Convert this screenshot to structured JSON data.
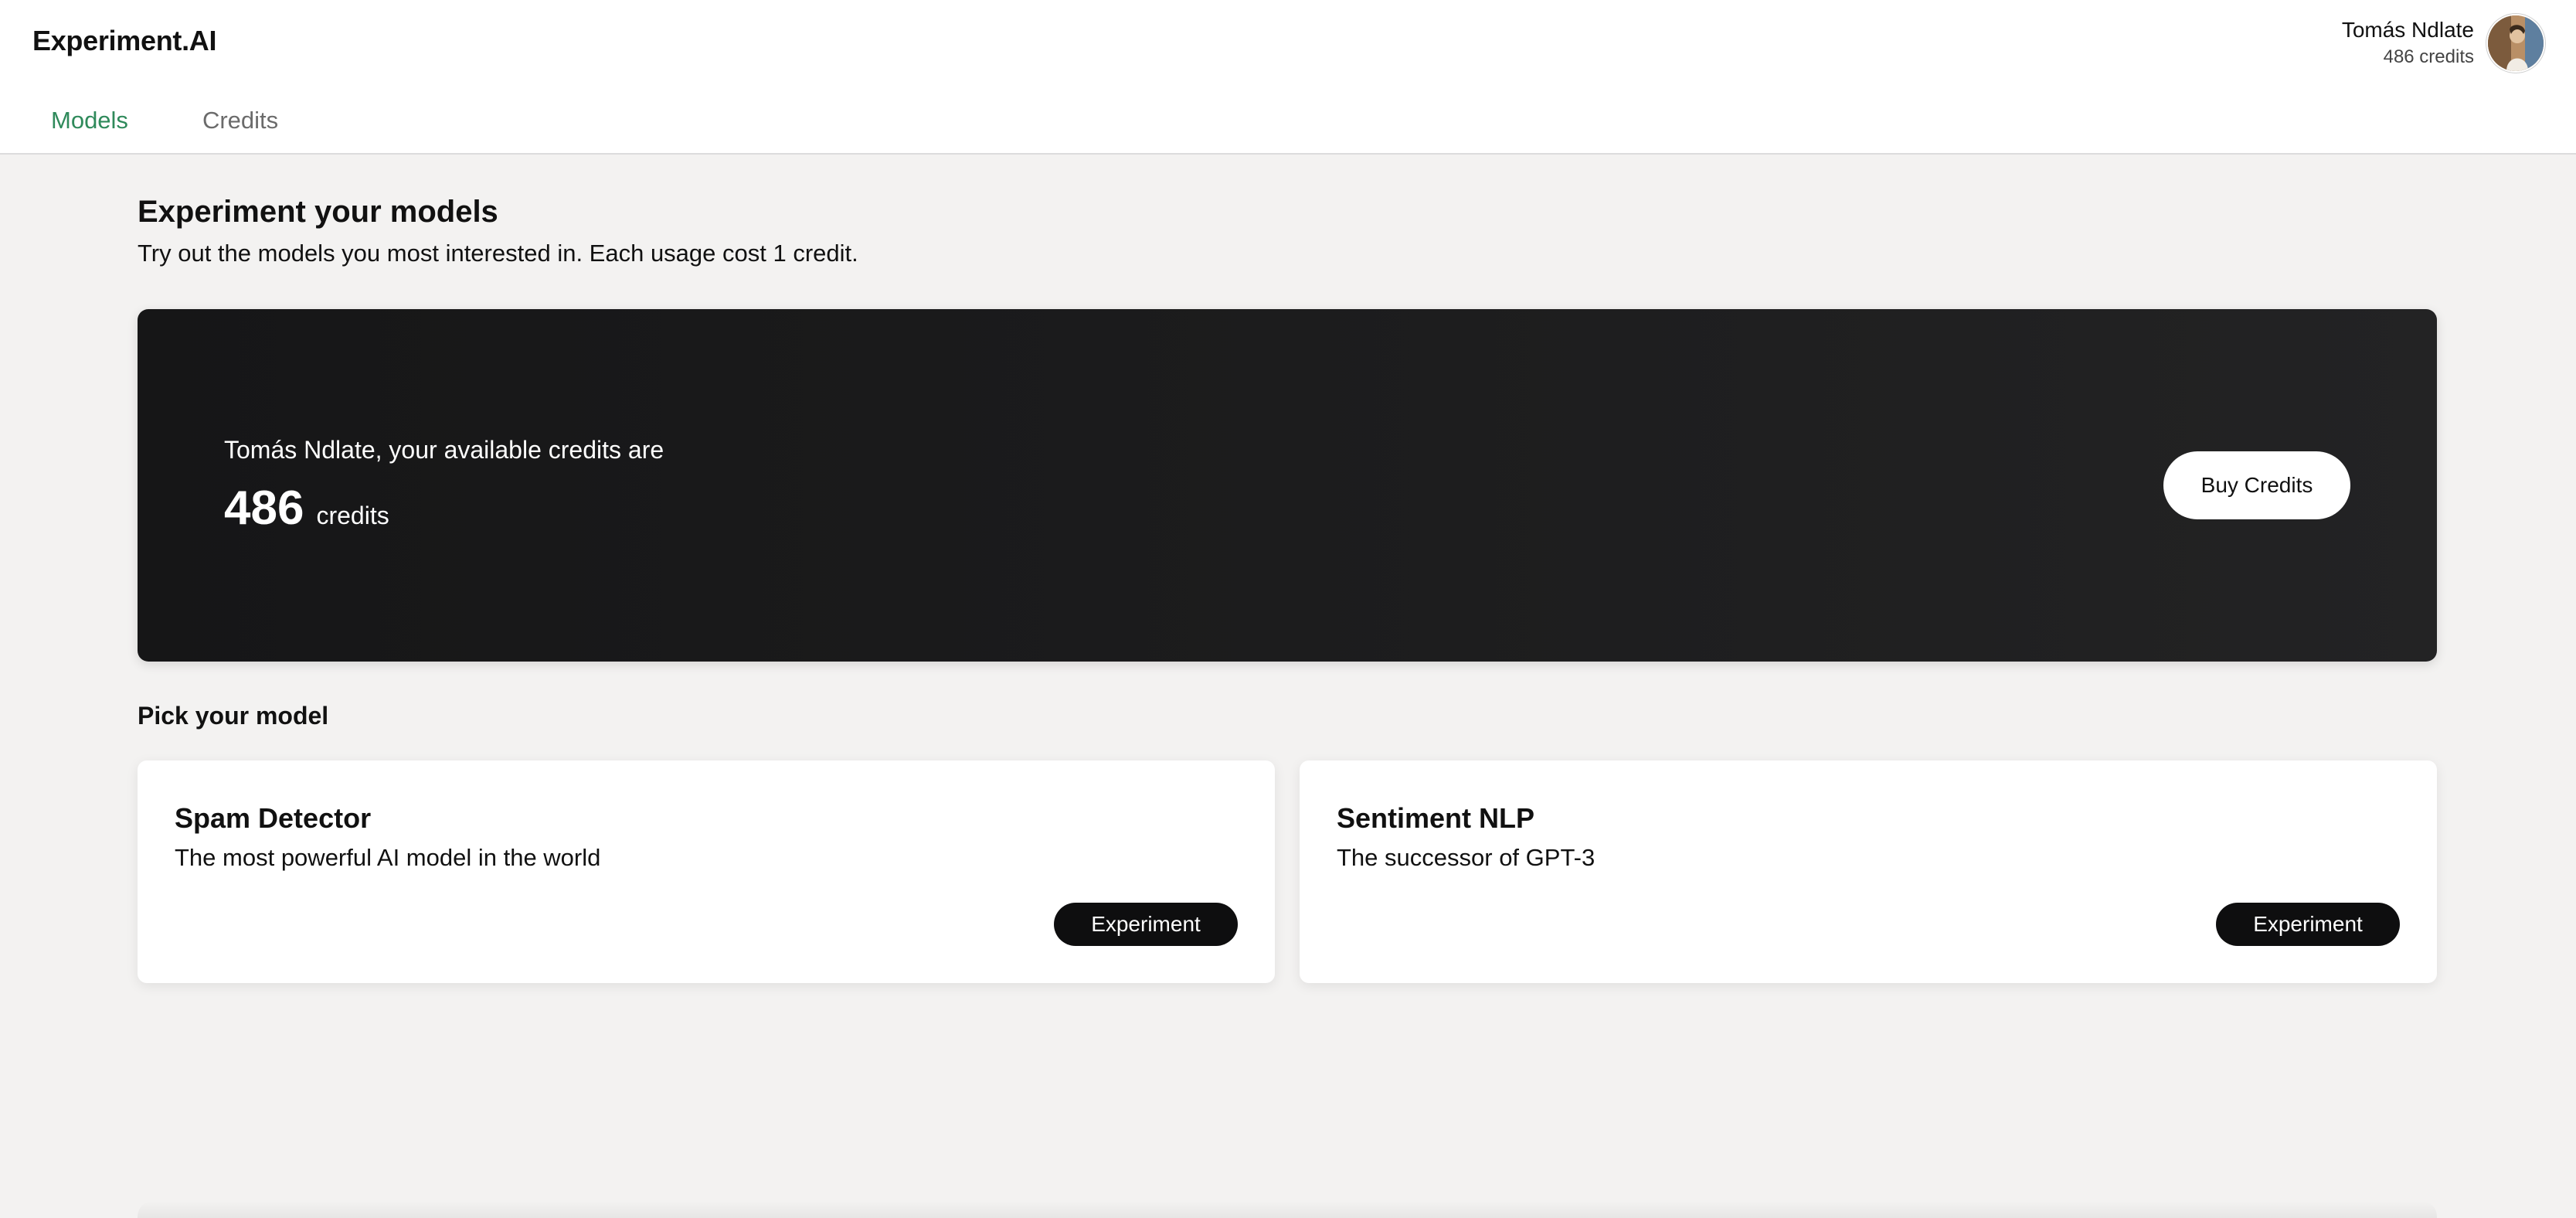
{
  "app": {
    "brand": "Experiment.AI"
  },
  "user": {
    "name": "Tomás Ndlate",
    "credits_label": "486 credits"
  },
  "nav": {
    "tabs": [
      {
        "label": "Models",
        "active": true
      },
      {
        "label": "Credits",
        "active": false
      }
    ],
    "active_color": "#2f8a5b"
  },
  "main": {
    "title": "Experiment your models",
    "subtitle": "Try out the models you most interested in. Each usage cost 1 credit."
  },
  "banner": {
    "greeting": "Tomás Ndlate, your available credits are",
    "amount": "486",
    "unit": "credits",
    "buy_label": "Buy Credits"
  },
  "models_section": {
    "title": "Pick your model",
    "models": [
      {
        "name": "Spam Detector",
        "description": "The most powerful AI model in the world",
        "action_label": "Experiment"
      },
      {
        "name": "Sentiment NLP",
        "description": "The successor of GPT-3",
        "action_label": "Experiment"
      }
    ]
  },
  "icons": {
    "avatar": "user-avatar-photo"
  }
}
